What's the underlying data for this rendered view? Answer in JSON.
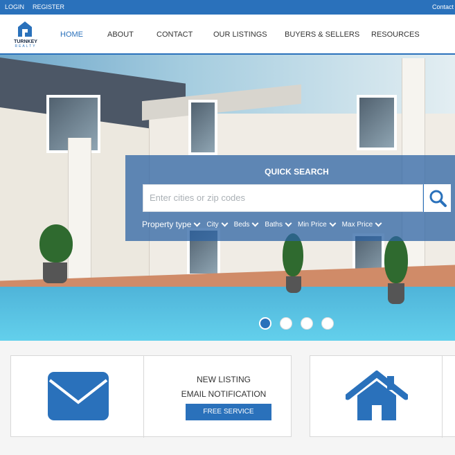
{
  "topbar": {
    "login": "LOGIN",
    "register": "REGISTER",
    "contact": "Contact"
  },
  "brand": {
    "name": "TURNKEY",
    "tagline": "REALTY"
  },
  "nav": [
    {
      "label": "HOME",
      "active": true
    },
    {
      "label": "ABOUT"
    },
    {
      "label": "CONTACT"
    },
    {
      "label": "OUR LISTINGS"
    },
    {
      "label": "BUYERS & SELLERS"
    },
    {
      "label": "RESOURCES"
    }
  ],
  "search": {
    "title": "QUICK SEARCH",
    "placeholder": "Enter cities or zip codes",
    "filters": [
      "Property type",
      "City",
      "Beds",
      "Baths",
      "Min Price",
      "Max Price"
    ]
  },
  "slider": {
    "slide_count": 4,
    "active_index": 0
  },
  "cards": {
    "notification": {
      "line1": "NEW LISTING",
      "line2": "EMAIL NOTIFICATION",
      "button": "FREE SERVICE"
    }
  },
  "colors": {
    "accent": "#2a71bb",
    "white": "#ffffff"
  },
  "icons": [
    "house-logo-icon",
    "search-icon",
    "envelope-icon",
    "home-icon",
    "chevron-down-icon"
  ]
}
